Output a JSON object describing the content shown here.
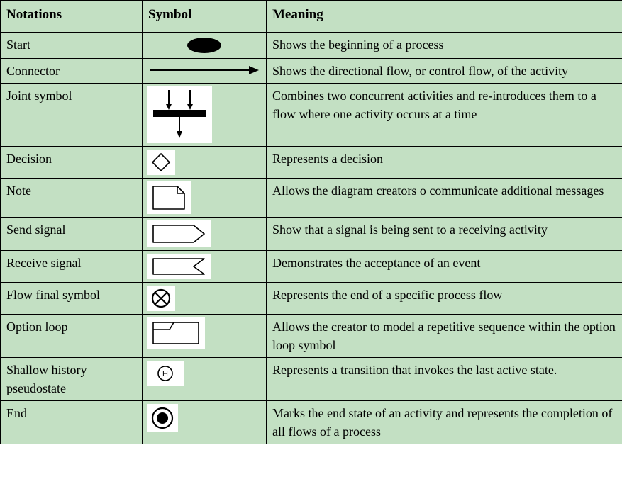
{
  "headers": {
    "notations": "Notations",
    "symbol": "Symbol",
    "meaning": "Meaning"
  },
  "rows": [
    {
      "notation": "Start",
      "icon": "start-icon",
      "meaning": "Shows the beginning of a process"
    },
    {
      "notation": "Connector",
      "icon": "connector-icon",
      "meaning": "Shows the directional flow, or control flow, of the activity"
    },
    {
      "notation": "Joint symbol",
      "icon": "joint-icon",
      "meaning": "Combines two concurrent activities and re-introduces them to a flow where one activity occurs at a time"
    },
    {
      "notation": "Decision",
      "icon": "decision-icon",
      "meaning": "Represents a decision"
    },
    {
      "notation": "Note",
      "icon": "note-icon",
      "meaning": "Allows the diagram creators o communicate additional messages"
    },
    {
      "notation": "Send signal",
      "icon": "send-signal-icon",
      "meaning": "Show that a signal is being sent to a receiving activity"
    },
    {
      "notation": "Receive signal",
      "icon": "receive-signal-icon",
      "meaning": "Demonstrates the acceptance of an event"
    },
    {
      "notation": "Flow final symbol",
      "icon": "flow-final-icon",
      "meaning": "Represents the end of a specific process flow"
    },
    {
      "notation": "Option loop",
      "icon": "option-loop-icon",
      "meaning": "Allows the creator to model a repetitive sequence within the option loop symbol"
    },
    {
      "notation": "Shallow history pseudostate",
      "icon": "shallow-history-icon",
      "meaning": "Represents a transition that invokes the last active state."
    },
    {
      "notation": "End",
      "icon": "end-icon",
      "meaning": "Marks the end state of an activity and represents the completion of all flows of a process"
    }
  ]
}
